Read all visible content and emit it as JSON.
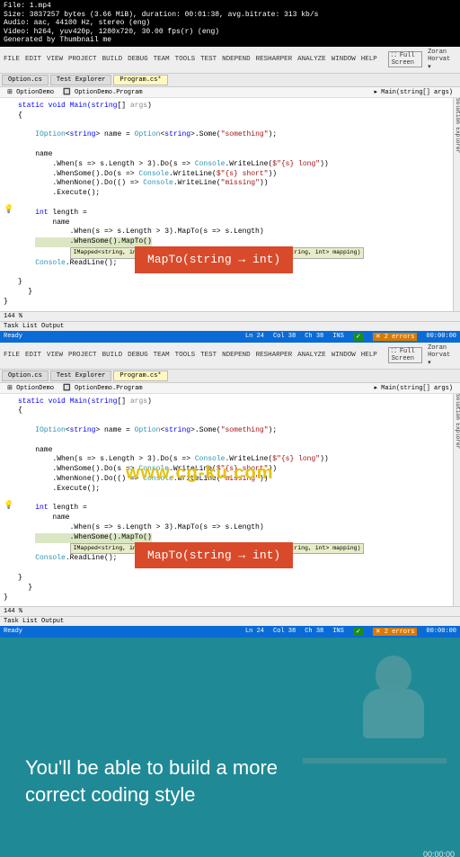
{
  "header": {
    "file": "File: 1.mp4",
    "size": "Size: 3837257 bytes (3.66 MiB), duration: 00:01:38, avg.bitrate: 313 kb/s",
    "audio": "Audio: aac, 44100 Hz, stereo (eng)",
    "video": "Video: h264, yuv420p, 1280x720, 30.00 fps(r) (eng)",
    "generated": "Generated by Thumbnail me"
  },
  "menu": {
    "items": [
      "FILE",
      "EDIT",
      "VIEW",
      "PROJECT",
      "BUILD",
      "DEBUG",
      "TEAM",
      "TOOLS",
      "TEST",
      "NDEPEND",
      "RESHARPER",
      "ANALYZE",
      "WINDOW",
      "HELP"
    ],
    "fullscreen": "⛶ Full Screen",
    "user": "Zoran Horvat ▾"
  },
  "tabs": {
    "t1": "Option.cs",
    "t2": "Test Explorer",
    "t3": "Program.cs*"
  },
  "breadcrumb": {
    "project": "⊞ OptionDemo",
    "class": "🔲 OptionDemo.Program",
    "method": "▸ Main(string[] args)"
  },
  "code": {
    "sig": "static void Main(string[] args)",
    "l0": "static void Main(",
    "l0b": "string",
    "l0c": "[] ",
    "l0d": "args",
    "l0e": ")",
    "brace_open": "{",
    "brace_close": "}",
    "l1a": "IOption",
    "l1b": "<",
    "l1c": "string",
    "l1d": "> name = ",
    "l1e": "Option",
    "l1f": "<",
    "l1g": "string",
    "l1h": ">.Some(",
    "l1i": "\"something\"",
    "l1j": ");",
    "name": "name",
    "l2": "    .When(s => s.Length > 3).Do(s => ",
    "l2b": "Console",
    "l2c": ".WriteLine(",
    "l2d": "$\"{s} long\"",
    "l2e": "))",
    "l3": "    .WhenSome().Do(s => ",
    "l3d": "$\"{s} short\"",
    "l4": "    .WhenNone().Do(() => ",
    "l4d": "\"missing\"",
    "l5": "    .Execute();",
    "l6a": "int",
    "l6b": " length =",
    "l7": "    name",
    "l8": "        .When(s => s.Length > 3).MapTo(s => s.Length)",
    "l9a": "        .WhenSome().MapTo(",
    "l9b": ")",
    "tooltip": "IMapped<string, int> IFilteredMapped<string, int>.MapTo(Func<string, int> mapping)",
    "readline": "Console",
    "readline2": ".ReadLine();"
  },
  "overlay": {
    "text": "MapTo(string → int)"
  },
  "bottombar": {
    "text": "Task List  Output",
    "pct": "144 %",
    "ready": "Ready"
  },
  "status": {
    "ln": "Ln 24",
    "col": "Col 38",
    "ch": "Ch 38",
    "ins": "INS",
    "err": "✕ 2 errors",
    "time": "00:00:00"
  },
  "watermark": "www.cg-ku.com",
  "teal": {
    "line1": "You'll be able to build a more",
    "line2": "correct coding style",
    "timestamp": "00:00:00"
  },
  "side": {
    "label": "Solution Explorer"
  }
}
